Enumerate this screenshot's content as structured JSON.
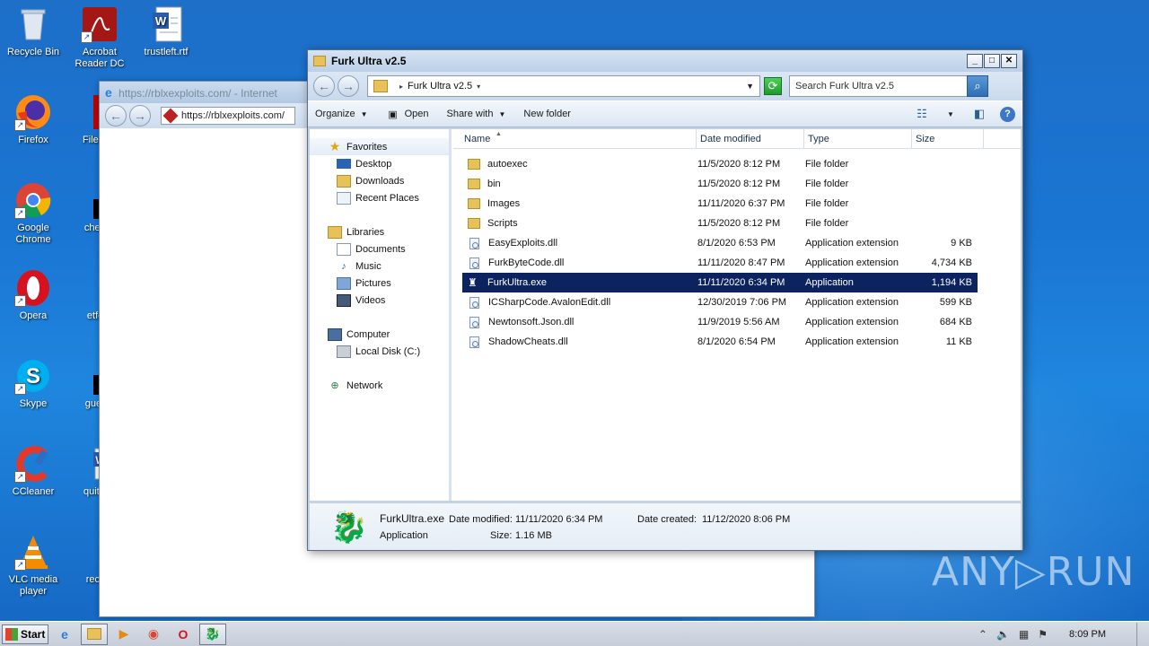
{
  "desktop": {
    "icons": [
      {
        "label": "Recycle Bin"
      },
      {
        "label": "Acrobat Reader DC"
      },
      {
        "label": "trustleft.rtf"
      },
      {
        "label": "Firefox"
      },
      {
        "label": "FileZilla"
      },
      {
        "label": "Google Chrome"
      },
      {
        "label": "checkv"
      },
      {
        "label": "Opera"
      },
      {
        "label": "etfore"
      },
      {
        "label": "Skype"
      },
      {
        "label": "guestc"
      },
      {
        "label": "CCleaner"
      },
      {
        "label": "quiteap"
      },
      {
        "label": "VLC media player"
      },
      {
        "label": "recom"
      }
    ]
  },
  "browser": {
    "title": "https://rblxexploits.com/ - Internet",
    "address": "https://rblxexploits.com/"
  },
  "explorer": {
    "title": "Furk Ultra v2.5",
    "breadcrumb": "Furk Ultra v2.5",
    "search_placeholder": "Search Furk Ultra v2.5",
    "toolbar": {
      "organize": "Organize",
      "open": "Open",
      "share_with": "Share with",
      "new_folder": "New folder"
    },
    "nav": {
      "favorites": "Favorites",
      "desktop": "Desktop",
      "downloads": "Downloads",
      "recent_places": "Recent Places",
      "libraries": "Libraries",
      "documents": "Documents",
      "music": "Music",
      "pictures": "Pictures",
      "videos": "Videos",
      "computer": "Computer",
      "local_disk": "Local Disk (C:)",
      "network": "Network"
    },
    "columns": {
      "name": "Name",
      "date_modified": "Date modified",
      "type": "Type",
      "size": "Size"
    },
    "files": [
      {
        "name": "autoexec",
        "date": "11/5/2020 8:12 PM",
        "type": "File folder",
        "size": "",
        "kind": "folder"
      },
      {
        "name": "bin",
        "date": "11/5/2020 8:12 PM",
        "type": "File folder",
        "size": "",
        "kind": "folder"
      },
      {
        "name": "Images",
        "date": "11/11/2020 6:37 PM",
        "type": "File folder",
        "size": "",
        "kind": "folder"
      },
      {
        "name": "Scripts",
        "date": "11/5/2020 8:12 PM",
        "type": "File folder",
        "size": "",
        "kind": "folder"
      },
      {
        "name": "EasyExploits.dll",
        "date": "8/1/2020 6:53 PM",
        "type": "Application extension",
        "size": "9 KB",
        "kind": "dll"
      },
      {
        "name": "FurkByteCode.dll",
        "date": "11/11/2020 8:47 PM",
        "type": "Application extension",
        "size": "4,734 KB",
        "kind": "dll"
      },
      {
        "name": "FurkUltra.exe",
        "date": "11/11/2020 6:34 PM",
        "type": "Application",
        "size": "1,194 KB",
        "kind": "exe",
        "selected": true
      },
      {
        "name": "ICSharpCode.AvalonEdit.dll",
        "date": "12/30/2019 7:06 PM",
        "type": "Application extension",
        "size": "599 KB",
        "kind": "dll"
      },
      {
        "name": "Newtonsoft.Json.dll",
        "date": "11/9/2019 5:56 AM",
        "type": "Application extension",
        "size": "684 KB",
        "kind": "dll"
      },
      {
        "name": "ShadowCheats.dll",
        "date": "8/1/2020 6:54 PM",
        "type": "Application extension",
        "size": "11 KB",
        "kind": "dll"
      }
    ],
    "details": {
      "name": "FurkUltra.exe",
      "type": "Application",
      "modified_label": "Date modified:",
      "modified_value": "11/11/2020 6:34 PM",
      "created_label": "Date created:",
      "created_value": "11/12/2020 8:06 PM",
      "size_label": "Size:",
      "size_value": "1.16 MB"
    }
  },
  "taskbar": {
    "start": "Start",
    "clock": "8:09 PM"
  },
  "watermark": "ANY▷RUN"
}
